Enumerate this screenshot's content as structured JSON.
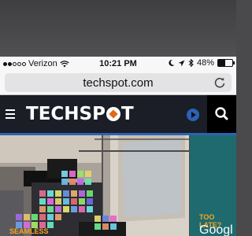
{
  "status_bar": {
    "carrier": "Verizon",
    "time": "10:21 PM",
    "battery_percent": "48%",
    "battery_level": 0.48,
    "signal_bars_filled": 2,
    "signal_bars_total": 5
  },
  "browser": {
    "url": "techspot.com"
  },
  "site_header": {
    "logo_prefix": "TECHSP",
    "logo_suffix": "T"
  },
  "articles": [
    {
      "kicker": "SEAMLESS"
    },
    {
      "kicker": "TOO LATE?",
      "title_partial": "Googl"
    }
  ],
  "colors": {
    "nav_bg": "#1b1e26",
    "nav_accent": "#2b63b5",
    "kicker": "#f5a623",
    "logo_accent": "#e06a1c"
  },
  "icons": {
    "wifi": "wifi-icon",
    "moon": "moon-icon",
    "location": "location-arrow-icon",
    "bluetooth": "bluetooth-icon",
    "reload": "reload-icon",
    "menu": "hamburger-menu-icon",
    "play": "play-icon",
    "search": "search-icon"
  }
}
